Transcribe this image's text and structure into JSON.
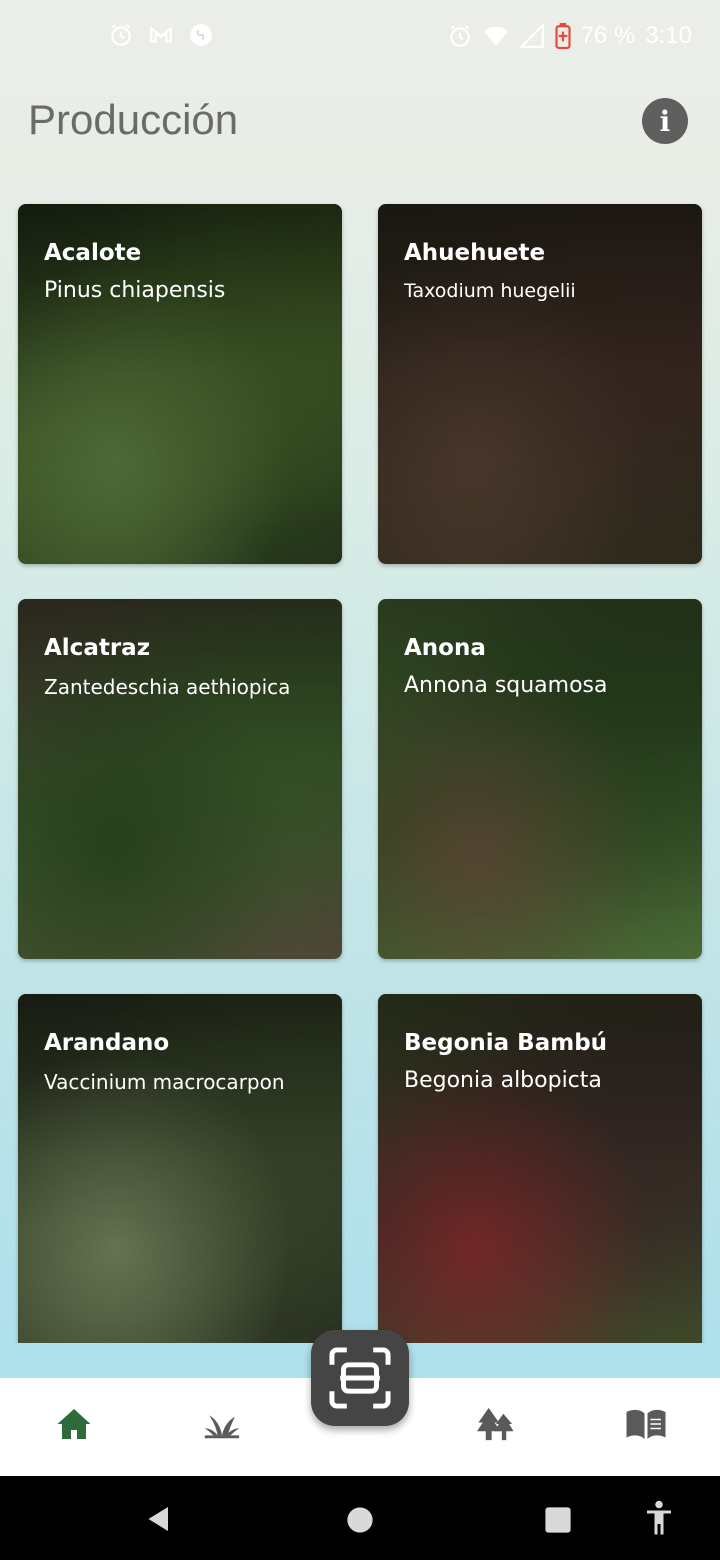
{
  "status_bar": {
    "battery_text": "76 %",
    "time": "3:10",
    "left_icons": [
      "alarm-icon",
      "gmail-icon",
      "shazam-icon"
    ],
    "right_icons": [
      "alarm-icon",
      "wifi-icon",
      "signal-icon",
      "battery-icon"
    ]
  },
  "app_bar": {
    "title": "Producción",
    "info_icon": "info-icon"
  },
  "plants": [
    {
      "name": "Acalote",
      "scientific": "Pinus chiapensis",
      "tone": [
        "#3f5a26",
        "#22331a",
        "#54713a"
      ]
    },
    {
      "name": "Ahuehuete",
      "scientific": "Taxodium huegelii",
      "tone": [
        "#3a2a22",
        "#2c2a1c",
        "#4d3a2d"
      ]
    },
    {
      "name": "Alcatraz",
      "scientific": "Zantedeschia aethiopica",
      "tone": [
        "#3a5a2a",
        "#4e4636",
        "#2b4520"
      ]
    },
    {
      "name": "Anona",
      "scientific": "Annona squamosa",
      "tone": [
        "#2e4a22",
        "#4b6a36",
        "#5b4a34"
      ]
    },
    {
      "name": "Arandano",
      "scientific": "Vaccinium macrocarpon",
      "tone": [
        "#3b4a2c",
        "#2a3221",
        "#6e7b58"
      ]
    },
    {
      "name": "Begonia Bambú",
      "scientific": "Begonia albopicta",
      "tone": [
        "#3b2e28",
        "#3f4a2a",
        "#7a2a2a"
      ]
    }
  ],
  "bottom_nav": {
    "items": [
      "home-icon",
      "plant-icon",
      "scan-icon",
      "trees-icon",
      "book-icon"
    ],
    "active_color": "#2e6b3a",
    "inactive_color": "#5a5a5a"
  }
}
